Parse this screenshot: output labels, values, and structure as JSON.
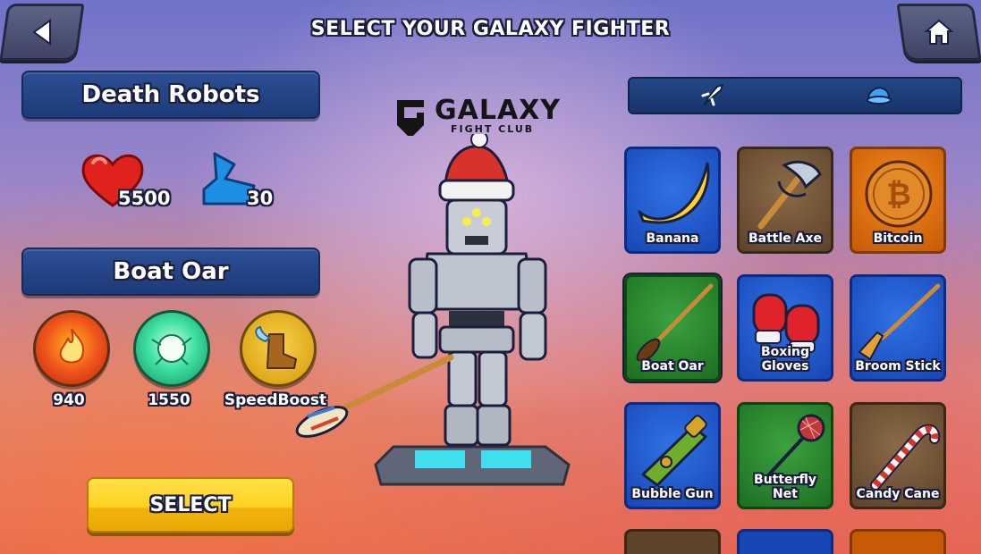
{
  "header": {
    "title": "SELECT YOUR GALAXY FIGHTER"
  },
  "icons": {
    "back": "back-arrow-icon",
    "home": "home-icon"
  },
  "character": {
    "name": "Death Robots",
    "health": "5500",
    "speed": "30"
  },
  "logo": {
    "line1": "GALAXY",
    "line2": "FIGHT CLUB"
  },
  "weapon": {
    "name": "Boat Oar",
    "abilities": [
      {
        "value": "940",
        "icon": "fire-orb-icon"
      },
      {
        "value": "1550",
        "icon": "energy-orb-icon"
      },
      {
        "value": "SpeedBoost",
        "icon": "winged-boot-icon"
      }
    ]
  },
  "select_button": {
    "label": "SELECT"
  },
  "tabs": [
    {
      "icon": "rocket-icon",
      "active": true
    },
    {
      "icon": "cap-icon",
      "active": false
    }
  ],
  "items": [
    {
      "label": "Banana",
      "color": "blue"
    },
    {
      "label": "Battle Axe",
      "color": "brown"
    },
    {
      "label": "Bitcoin",
      "color": "orange"
    },
    {
      "label": "Boat Oar",
      "color": "green"
    },
    {
      "label": "Boxing Gloves",
      "color": "blue"
    },
    {
      "label": "Broom Stick",
      "color": "blue"
    },
    {
      "label": "Bubble Gun",
      "color": "blue"
    },
    {
      "label": "Butterfly Net",
      "color": "green"
    },
    {
      "label": "Candy Cane",
      "color": "brown"
    }
  ],
  "colors": {
    "accent_yellow": "#ffd21f",
    "panel_blue": "#1d3a78"
  }
}
